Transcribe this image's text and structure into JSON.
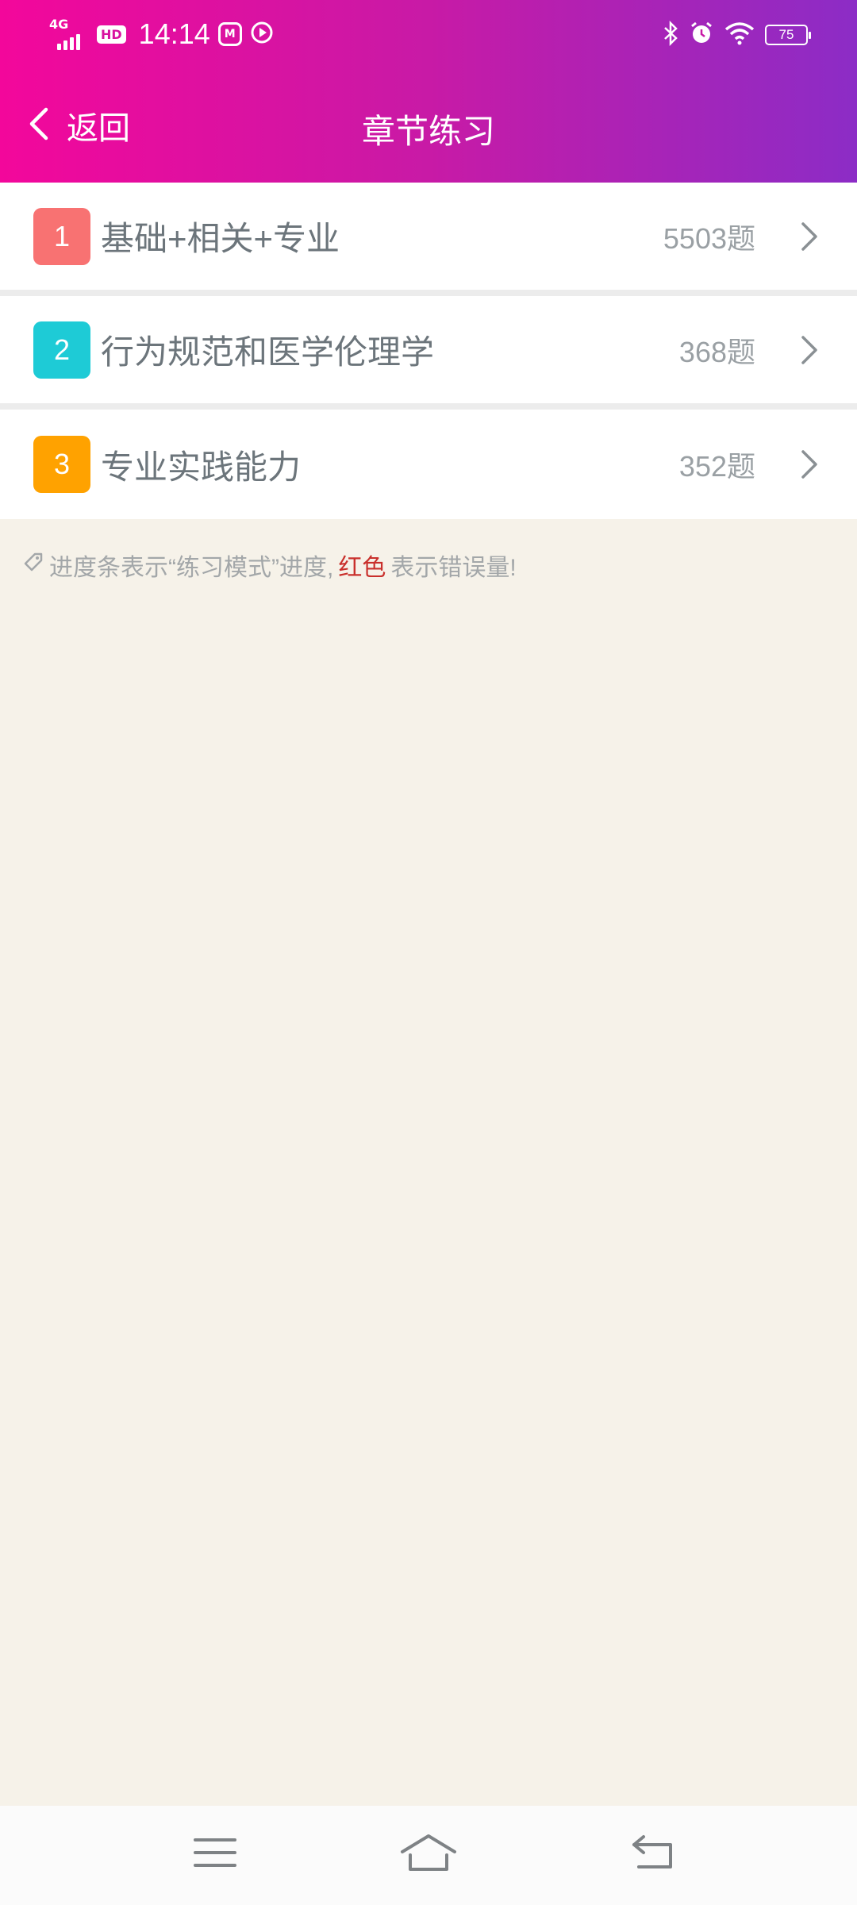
{
  "status_bar": {
    "network": "4G",
    "hd": "HD",
    "time": "14:14",
    "app_icon_letter": "M",
    "battery": "75"
  },
  "nav": {
    "back_label": "返回",
    "title": "章节练习"
  },
  "chapters": [
    {
      "number": "1",
      "title": "基础+相关+专业",
      "count": "5503题",
      "color": "#f87272"
    },
    {
      "number": "2",
      "title": "行为规范和医学伦理学",
      "count": "368题",
      "color": "#1ecbd6"
    },
    {
      "number": "3",
      "title": "专业实践能力",
      "count": "352题",
      "color": "#ffa200"
    }
  ],
  "hint": {
    "part1": "进度条表示“练习模式”进度,",
    "highlight": "红色",
    "part2": "表示错误量!"
  },
  "colors": {
    "header_gradient_start": "#f3079b",
    "header_gradient_end": "#8c2cc6",
    "page_background": "#f6f2e9",
    "hint_highlight": "#c9302c"
  },
  "icons": {
    "back": "chevron-left-icon",
    "row_arrow": "chevron-right-icon",
    "hint": "tag-icon",
    "menu": "menu-icon",
    "home": "home-icon",
    "return": "return-icon"
  }
}
